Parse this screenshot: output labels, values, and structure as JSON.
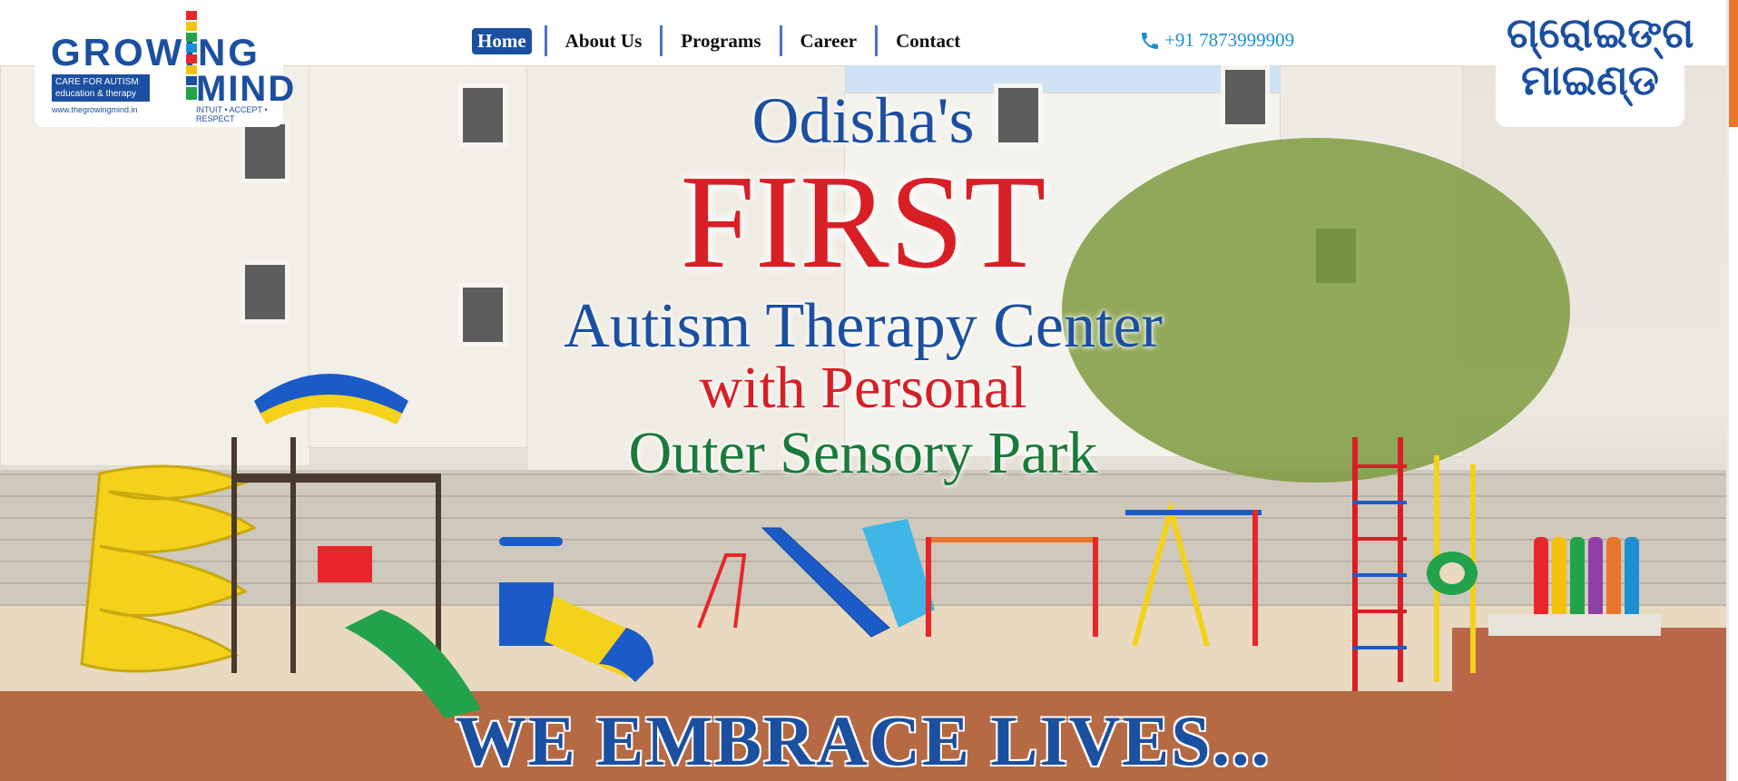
{
  "brand": {
    "logo_left": {
      "line1": "GROWING",
      "line2": "MIND",
      "box_text": "CARE FOR AUTISM education & therapy",
      "url": "www.thegrowingmind.in",
      "tagline": "INTUIT • ACCEPT • RESPECT"
    },
    "logo_right_text": "ଗ୍ରୋଇଙ୍ଗ ମାଇଣ୍ଡ"
  },
  "nav": {
    "items": [
      {
        "label": "Home",
        "active": true
      },
      {
        "label": "About Us",
        "active": false
      },
      {
        "label": "Programs",
        "active": false
      },
      {
        "label": "Career",
        "active": false
      },
      {
        "label": "Contact",
        "active": false
      }
    ]
  },
  "contact": {
    "phone": "+91 7873999909",
    "icon": "phone-icon"
  },
  "hero": {
    "line1": "Odisha's",
    "line2": "FIRST",
    "line3": "Autism Therapy Center",
    "line4": "with Personal",
    "line5": "Outer Sensory Park",
    "bottom": "WE EMBRACE LIVES..."
  },
  "colors": {
    "brand_blue": "#1b4fa0",
    "accent_red": "#d81f26",
    "accent_green": "#1a7a3a",
    "phone_blue": "#1b8fd0",
    "scroll_accent": "#e8762c"
  }
}
